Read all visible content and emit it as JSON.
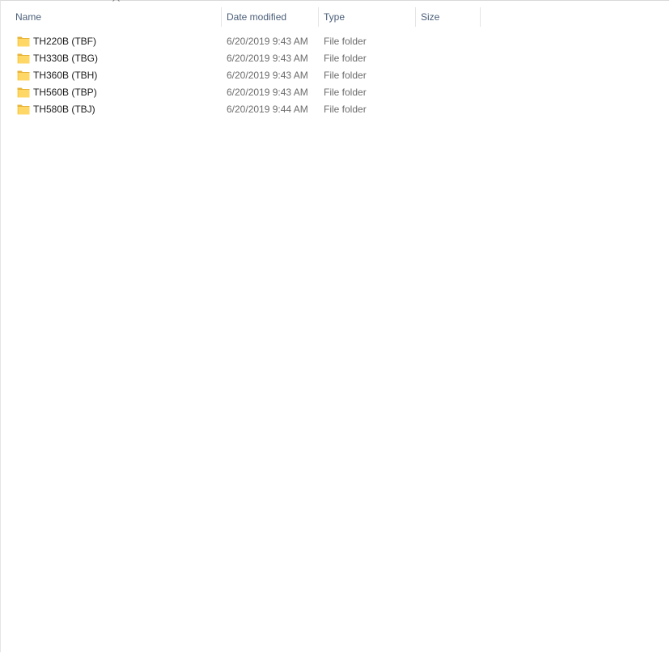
{
  "columns": {
    "name": "Name",
    "date_modified": "Date modified",
    "type": "Type",
    "size": "Size"
  },
  "sort": {
    "column": "name",
    "direction": "ascending",
    "icon": "sort-up-arrow-icon"
  },
  "files": [
    {
      "name": "TH220B (TBF)",
      "date_modified": "6/20/2019 9:43 AM",
      "type": "File folder",
      "size": "",
      "icon": "folder-icon"
    },
    {
      "name": "TH330B (TBG)",
      "date_modified": "6/20/2019 9:43 AM",
      "type": "File folder",
      "size": "",
      "icon": "folder-icon"
    },
    {
      "name": "TH360B (TBH)",
      "date_modified": "6/20/2019 9:43 AM",
      "type": "File folder",
      "size": "",
      "icon": "folder-icon"
    },
    {
      "name": "TH560B (TBP)",
      "date_modified": "6/20/2019 9:43 AM",
      "type": "File folder",
      "size": "",
      "icon": "folder-icon"
    },
    {
      "name": "TH580B (TBJ)",
      "date_modified": "6/20/2019 9:44 AM",
      "type": "File folder",
      "size": "",
      "icon": "folder-icon"
    }
  ],
  "colors": {
    "header_text": "#4c607a",
    "name_text": "#1a1a1a",
    "secondary_text": "#6d6d6d",
    "folder_fill": "#ffd767",
    "folder_dark": "#e8b43a"
  }
}
